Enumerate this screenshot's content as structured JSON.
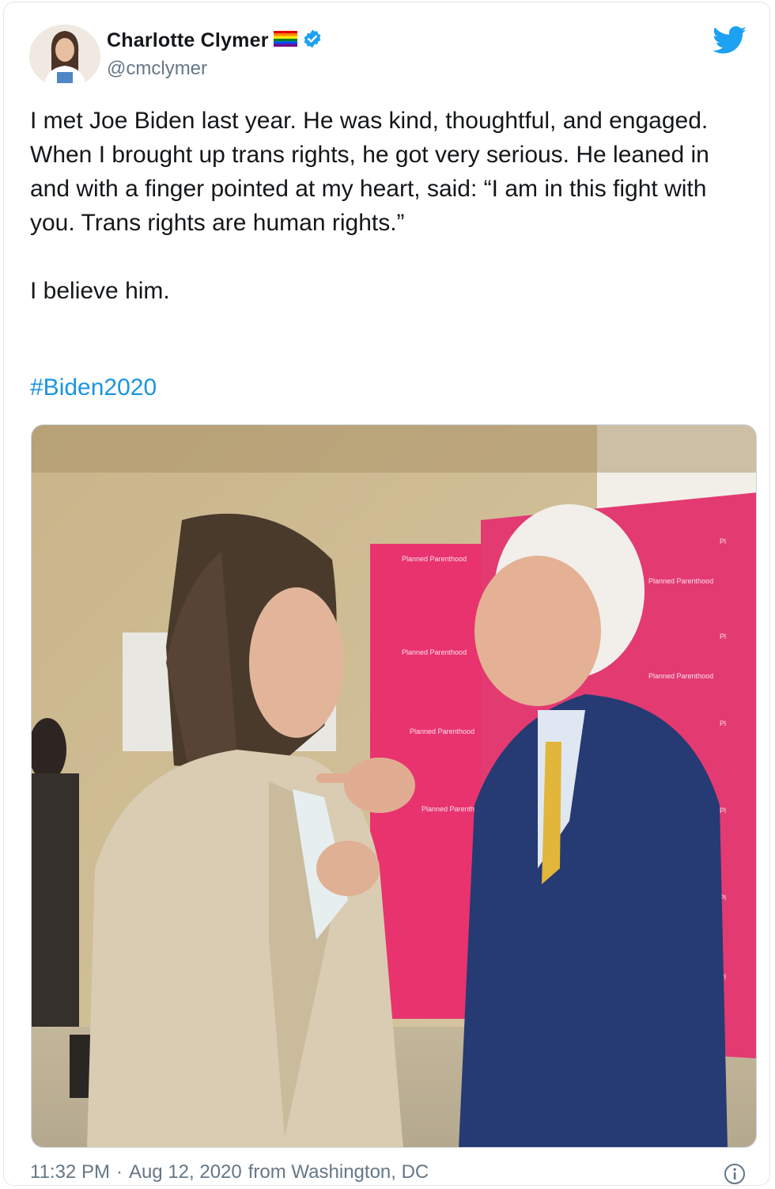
{
  "tweet": {
    "author_name": "Charlotte Clymer",
    "handle": "@cmclymer",
    "text": "I met Joe Biden last year. He was kind, thoughtful, and engaged. When I brought up trans rights, he got very serious. He leaned in and with a finger pointed at my heart, said: “I am in this fight with you. Trans rights are human rights.”\n\nI believe him.",
    "hashtag": "#Biden2020",
    "time": "11:32 PM",
    "separator": "·",
    "date": "Aug 12, 2020",
    "location_text": "from Washington, DC",
    "backdrop_logo_text": "Planned Parenthood"
  },
  "icons": {
    "bird": "twitter-bird-icon",
    "verified": "verified-badge-icon",
    "rainbow": "rainbow-flag-icon",
    "info": "info-icon"
  },
  "colors": {
    "link": "#1b95e0",
    "twitter_blue": "#1da1f2",
    "secondary_text": "#657786",
    "backdrop_pink": "#e8336f"
  }
}
